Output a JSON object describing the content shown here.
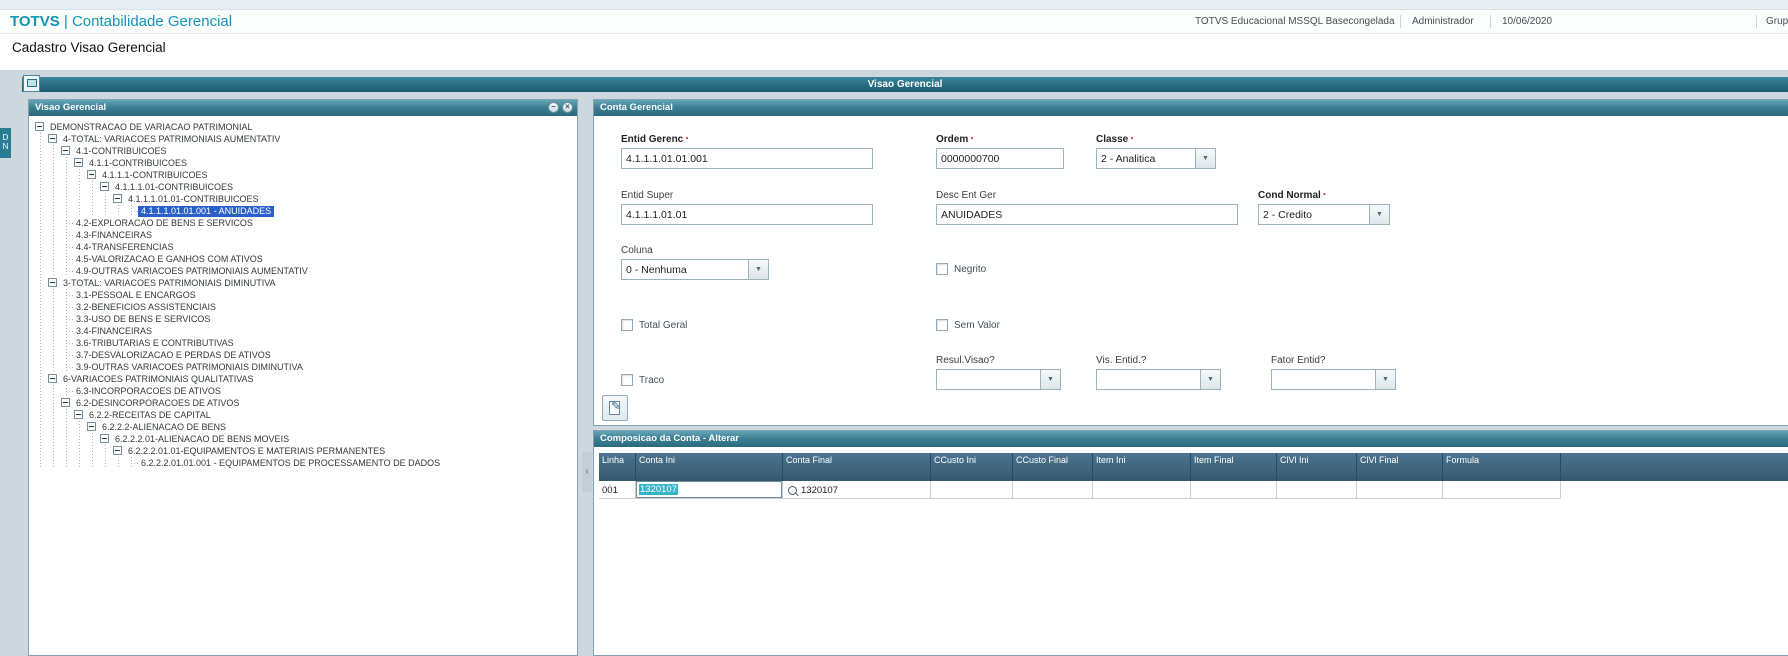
{
  "header": {
    "brand_left": "TOTVS",
    "brand_right": "| Contabilidade Gerencial",
    "environment": "TOTVS Educacional MSSQL Basecongelada",
    "user": "Administrador",
    "date": "10/06/2020",
    "group": "Grupo"
  },
  "page_title": "Cadastro Visao Gerencial",
  "window_title": "Visao Gerencial",
  "side_tab": {
    "line1": "D",
    "line2": "N"
  },
  "tree_panel": {
    "title": "Visao Gerencial",
    "nodes": [
      {
        "level": 0,
        "exp": true,
        "sel": false,
        "label": "DEMONSTRACAO DE VARIACAO PATRIMONIAL"
      },
      {
        "level": 1,
        "exp": true,
        "sel": false,
        "label": "4-TOTAL: VARIACOES PATRIMONIAIS AUMENTATIV"
      },
      {
        "level": 2,
        "exp": true,
        "sel": false,
        "label": "4.1-CONTRIBUICOES"
      },
      {
        "level": 3,
        "exp": true,
        "sel": false,
        "label": "4.1.1-CONTRIBUICOES"
      },
      {
        "level": 4,
        "exp": true,
        "sel": false,
        "label": "4.1.1.1-CONTRIBUICOES"
      },
      {
        "level": 5,
        "exp": true,
        "sel": false,
        "label": "4.1.1.1.01-CONTRIBUICOES"
      },
      {
        "level": 6,
        "exp": true,
        "sel": false,
        "label": "4.1.1.1.01.01-CONTRIBUICOES"
      },
      {
        "level": 7,
        "exp": false,
        "sel": true,
        "label": "4.1.1.1.01.01.001 - ANUIDADES"
      },
      {
        "level": 2,
        "exp": false,
        "sel": false,
        "label": "4.2-EXPLORACAO DE BENS E SERVICOS"
      },
      {
        "level": 2,
        "exp": false,
        "sel": false,
        "label": "4.3-FINANCEIRAS"
      },
      {
        "level": 2,
        "exp": false,
        "sel": false,
        "label": "4.4-TRANSFERENCIAS"
      },
      {
        "level": 2,
        "exp": false,
        "sel": false,
        "label": "4.5-VALORIZACAO E GANHOS COM ATIVOS"
      },
      {
        "level": 2,
        "exp": false,
        "sel": false,
        "label": "4.9-OUTRAS VARIACOES PATRIMONIAIS AUMENTATIV"
      },
      {
        "level": 1,
        "exp": true,
        "sel": false,
        "label": "3-TOTAL: VARIACOES PATRIMONIAIS DIMINUTIVA"
      },
      {
        "level": 2,
        "exp": false,
        "sel": false,
        "label": "3.1-PESSOAL E ENCARGOS"
      },
      {
        "level": 2,
        "exp": false,
        "sel": false,
        "label": "3.2-BENEFICIOS ASSISTENCIAIS"
      },
      {
        "level": 2,
        "exp": false,
        "sel": false,
        "label": "3.3-USO DE BENS E SERVICOS"
      },
      {
        "level": 2,
        "exp": false,
        "sel": false,
        "label": "3.4-FINANCEIRAS"
      },
      {
        "level": 2,
        "exp": false,
        "sel": false,
        "label": "3.6-TRIBUTARIAS E CONTRIBUTIVAS"
      },
      {
        "level": 2,
        "exp": false,
        "sel": false,
        "label": "3.7-DESVALORIZACAO E PERDAS DE ATIVOS"
      },
      {
        "level": 2,
        "exp": false,
        "sel": false,
        "label": "3.9-OUTRAS VARIACOES PATRIMONIAIS DIMINUTIVA"
      },
      {
        "level": 1,
        "exp": true,
        "sel": false,
        "label": "6-VARIACOES PATRIMONIAIS QUALITATIVAS"
      },
      {
        "level": 2,
        "exp": false,
        "sel": false,
        "label": "6.3-INCORPORACOES DE ATIVOS"
      },
      {
        "level": 2,
        "exp": true,
        "sel": false,
        "label": "6.2-DESINCORPORACOES DE ATIVOS"
      },
      {
        "level": 3,
        "exp": true,
        "sel": false,
        "label": "6.2.2-RECEITAS DE CAPITAL"
      },
      {
        "level": 4,
        "exp": true,
        "sel": false,
        "label": "6.2.2.2-ALIENACAO DE BENS"
      },
      {
        "level": 5,
        "exp": true,
        "sel": false,
        "label": "6.2.2.2.01-ALIENACAO DE BENS MOVEIS"
      },
      {
        "level": 6,
        "exp": true,
        "sel": false,
        "label": "6.2.2.2.01.01-EQUIPAMENTOS E MATERIAIS PERMANENTES"
      },
      {
        "level": 7,
        "exp": false,
        "sel": false,
        "label": "6.2.2.2.01.01.001 - EQUIPAMENTOS DE PROCESSAMENTO DE DADOS"
      }
    ]
  },
  "form_panel": {
    "title": "Conta Gerencial",
    "required_marker": "·",
    "entid_gerenc_label": "Entid Gerenc",
    "entid_gerenc_value": "4.1.1.1.01.01.001",
    "ordem_label": "Ordem",
    "ordem_value": "0000000700",
    "classe_label": "Classe",
    "classe_value": "2 - Analitica",
    "entid_super_label": "Entid Super",
    "entid_super_value": "4.1.1.1.01.01",
    "desc_ent_ger_label": "Desc Ent Ger",
    "desc_ent_ger_value": "ANUIDADES",
    "cond_normal_label": "Cond Normal",
    "cond_normal_value": "2 - Credito",
    "coluna_label": "Coluna",
    "coluna_value": "0 - Nenhuma",
    "negrito_label": "Negrito",
    "total_geral_label": "Total Geral",
    "sem_valor_label": "Sem Valor",
    "traco_label": "Traco",
    "resul_visao_label": "Resul.Visao?",
    "vis_entid_label": "Vis. Entid.?",
    "fator_entid_label": "Fator Entid?",
    "resul_visao_value": "",
    "vis_entid_value": "",
    "fator_entid_value": ""
  },
  "grid_panel": {
    "title": "Composicao da Conta - Alterar",
    "columns": [
      "Linha",
      "Conta Ini",
      "Conta Final",
      "CCusto Ini",
      "CCusto Final",
      "Item Ini",
      "Item Final",
      "ClVl Ini",
      "ClVl Final",
      "Formula"
    ],
    "rows": [
      {
        "linha": "001",
        "conta_ini": "1320107",
        "conta_final": "1320107"
      }
    ]
  }
}
